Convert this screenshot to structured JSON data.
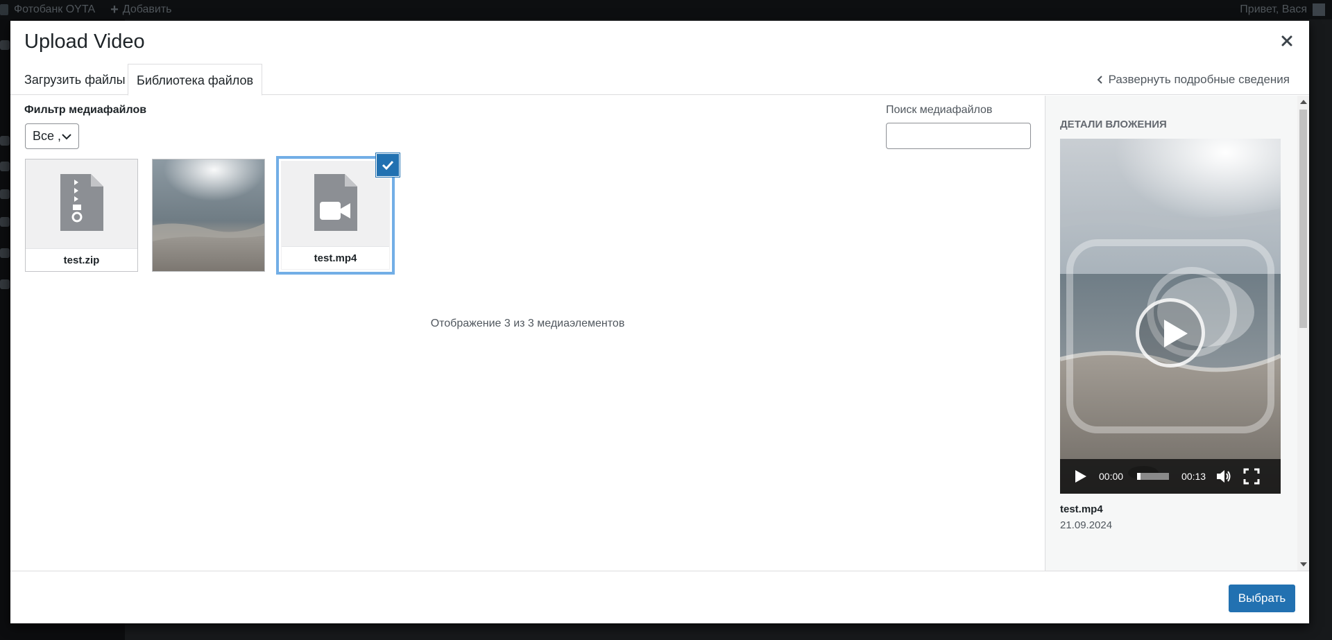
{
  "adminbar": {
    "site_name": "Фотобанк OYTA",
    "add_label": "Добавить",
    "greeting": "Привет, Вася"
  },
  "modal": {
    "title": "Upload Video",
    "close_icon": "close-icon"
  },
  "router": {
    "tabs": [
      {
        "label": "Загрузить файлы",
        "active": false
      },
      {
        "label": "Библиотека файлов",
        "active": true
      }
    ],
    "expand_label": "Развернуть подробные сведения"
  },
  "filters": {
    "label": "Фильтр медиафайлов",
    "selected": "Все ,"
  },
  "search": {
    "label": "Поиск медиафайлов",
    "value": ""
  },
  "attachments": [
    {
      "filename": "test.zip",
      "type": "archive",
      "icon": "zip-file-icon",
      "selected": false
    },
    {
      "filename": "",
      "type": "image",
      "icon": "image-thumbnail",
      "selected": false
    },
    {
      "filename": "test.mp4",
      "type": "video",
      "icon": "video-file-icon",
      "selected": true
    }
  ],
  "count_text": "Отображение 3 из 3 медиаэлементов",
  "details": {
    "heading": "Детали вложения",
    "filename": "test.mp4",
    "date": "21.09.2024",
    "player": {
      "current_time": "00:00",
      "duration": "00:13",
      "progress": 0.1
    }
  },
  "toolbar": {
    "select_label": "Выбрать"
  },
  "colors": {
    "accent": "#2271b1",
    "selected_outline": "#72aee6"
  }
}
